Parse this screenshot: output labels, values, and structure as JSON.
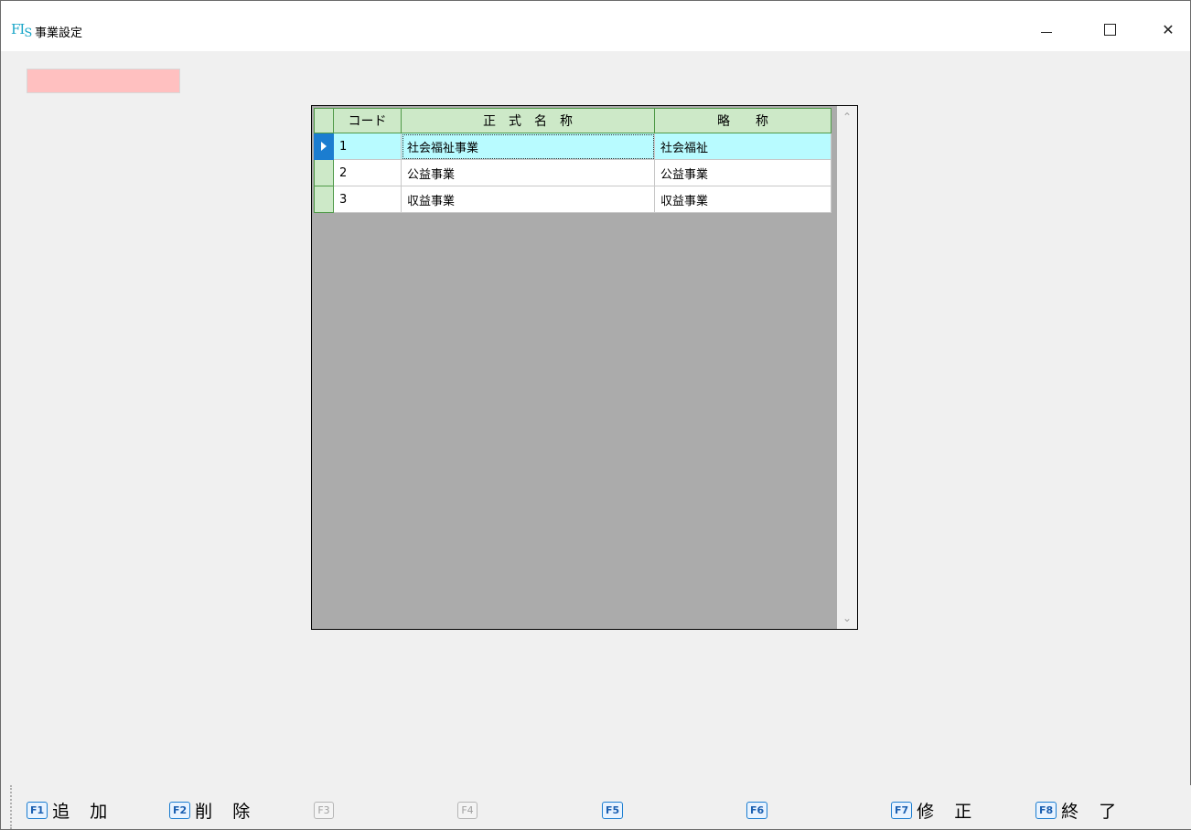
{
  "window": {
    "logo_main": "FI",
    "logo_sub": "S",
    "title": "事業設定"
  },
  "grid": {
    "columns": [
      "コード",
      "正　式　名　称",
      "略　　称"
    ],
    "rows": [
      {
        "code": "1",
        "formal_name": "社会福祉事業",
        "short_name": "社会福祉"
      },
      {
        "code": "2",
        "formal_name": "公益事業",
        "short_name": "公益事業"
      },
      {
        "code": "3",
        "formal_name": "収益事業",
        "short_name": "収益事業"
      }
    ],
    "selected_row": 1,
    "scroll_up": "⌃",
    "scroll_down": "⌄"
  },
  "fkeys": [
    {
      "key": "F1",
      "label": "追 加",
      "enabled": true
    },
    {
      "key": "F2",
      "label": "削 除",
      "enabled": true
    },
    {
      "key": "F3",
      "label": "",
      "enabled": false
    },
    {
      "key": "F4",
      "label": "",
      "enabled": false
    },
    {
      "key": "F5",
      "label": "",
      "enabled": true
    },
    {
      "key": "F6",
      "label": "",
      "enabled": true
    },
    {
      "key": "F7",
      "label": "修 正",
      "enabled": true
    },
    {
      "key": "F8",
      "label": "終 了",
      "enabled": true
    }
  ],
  "colors": {
    "header_green": "#cde9c8",
    "selected_cyan": "#b8fbff",
    "pink_field": "#ffc0c0",
    "accent_blue": "#1b7dd0"
  }
}
